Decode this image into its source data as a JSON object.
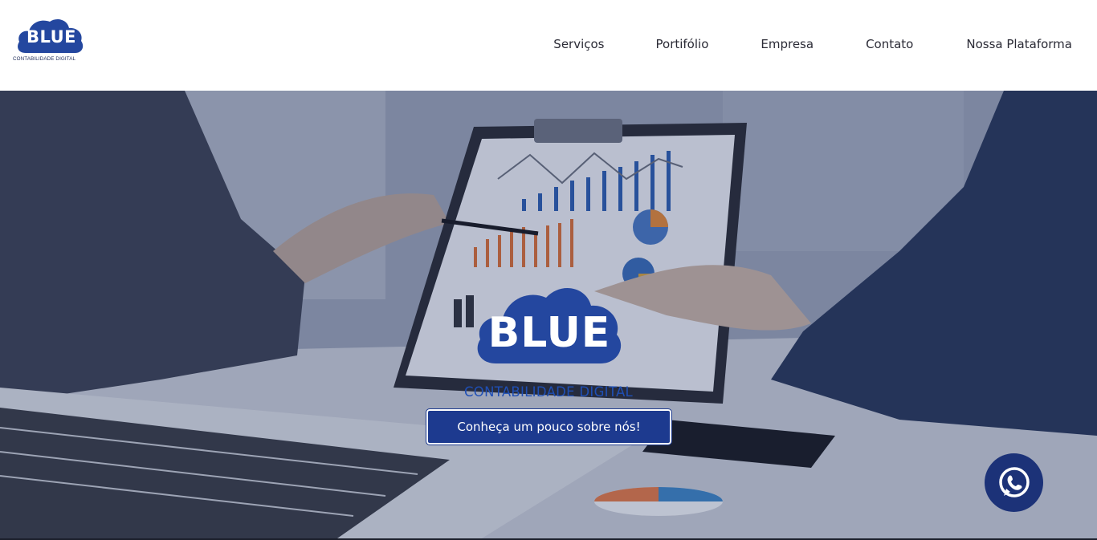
{
  "brand": {
    "name": "BLUE",
    "tagline": "CONTABILIDADE DIGITAL",
    "color": "#24479f"
  },
  "nav": {
    "items": [
      {
        "label": "Serviços"
      },
      {
        "label": "Portifólio"
      },
      {
        "label": "Empresa"
      },
      {
        "label": "Contato"
      },
      {
        "label": "Nossa Plataforma"
      }
    ]
  },
  "hero": {
    "logo_text": "BLUE",
    "subtitle": "CONTABILIDADE DIGITAL",
    "cta_label": "Conheça um pouco sobre nós!",
    "cta_color": "#1d3a8f"
  },
  "floating": {
    "icon": "whatsapp-icon",
    "color": "#1c3278"
  }
}
